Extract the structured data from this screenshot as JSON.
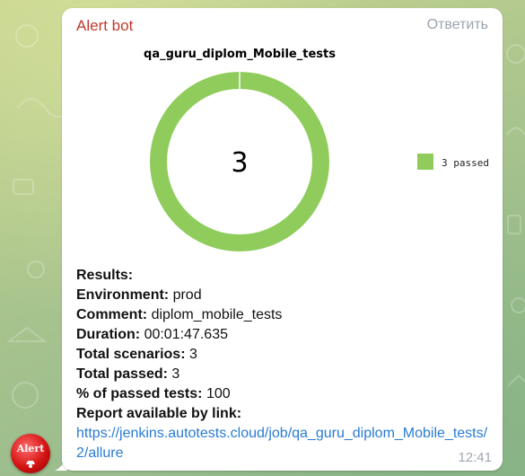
{
  "message": {
    "sender": "Alert bot",
    "reply_label": "Ответить",
    "time": "12:41"
  },
  "chart_data": {
    "type": "pie",
    "title": "qa_guru_diplom_Mobile_tests",
    "center_label": "3",
    "categories": [
      "passed"
    ],
    "values": [
      3
    ],
    "legend": [
      {
        "label": "3 passed",
        "color": "#8fcc5c"
      }
    ],
    "legend_position": "right"
  },
  "results": {
    "heading": "Results:",
    "environment_label": "Environment:",
    "environment_value": "prod",
    "comment_label": "Comment:",
    "comment_value": "diplom_mobile_tests",
    "duration_label": "Duration:",
    "duration_value": "00:01:47.635",
    "total_scenarios_label": "Total scenarios:",
    "total_scenarios_value": "3",
    "total_passed_label": "Total passed:",
    "total_passed_value": "3",
    "percent_label": "% of passed tests:",
    "percent_value": "100",
    "report_label": "Report available by link:",
    "report_link": "https://jenkins.autotests.cloud/job/qa_guru_diplom_Mobile_tests/2/allure"
  },
  "avatar": {
    "text": "Alert"
  },
  "colors": {
    "chart_green": "#8fcc5c",
    "sender_red": "#c0392b",
    "link_blue": "#2a7bd3",
    "wallpaper": "#a9c48d"
  }
}
